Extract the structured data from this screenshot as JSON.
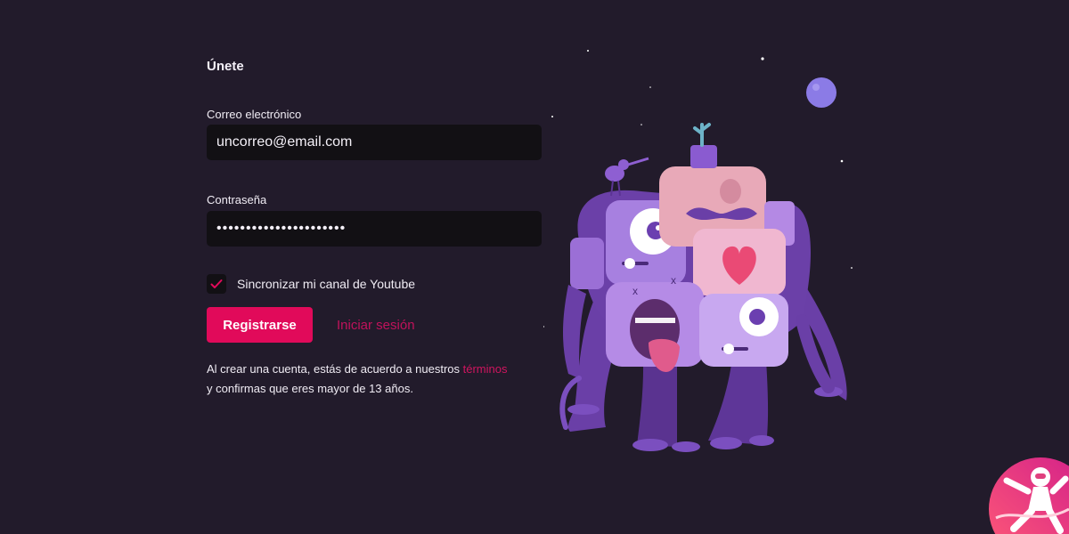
{
  "form": {
    "title": "Únete",
    "email": {
      "label": "Correo electrónico",
      "value": "uncorreo@email.com"
    },
    "password": {
      "label": "Contraseña",
      "value": "••••••••••••••••••••••"
    },
    "sync": {
      "label": "Sincronizar mi canal de Youtube",
      "checked": true
    },
    "submit_label": "Registrarse",
    "login_link": "Iniciar sesión",
    "legal": {
      "line1": "Al crear una cuenta, estás de acuerdo a nuestros",
      "terms_link": "términos",
      "line2": "y confirmas que eres mayor de 13 años."
    }
  },
  "illustration": {
    "icon": "monster-stack-illustration"
  },
  "badge": {
    "icon": "astronaut-badge-icon"
  },
  "colors": {
    "background": "#221b2b",
    "accent": "#e10a5a",
    "field": "#121014"
  }
}
